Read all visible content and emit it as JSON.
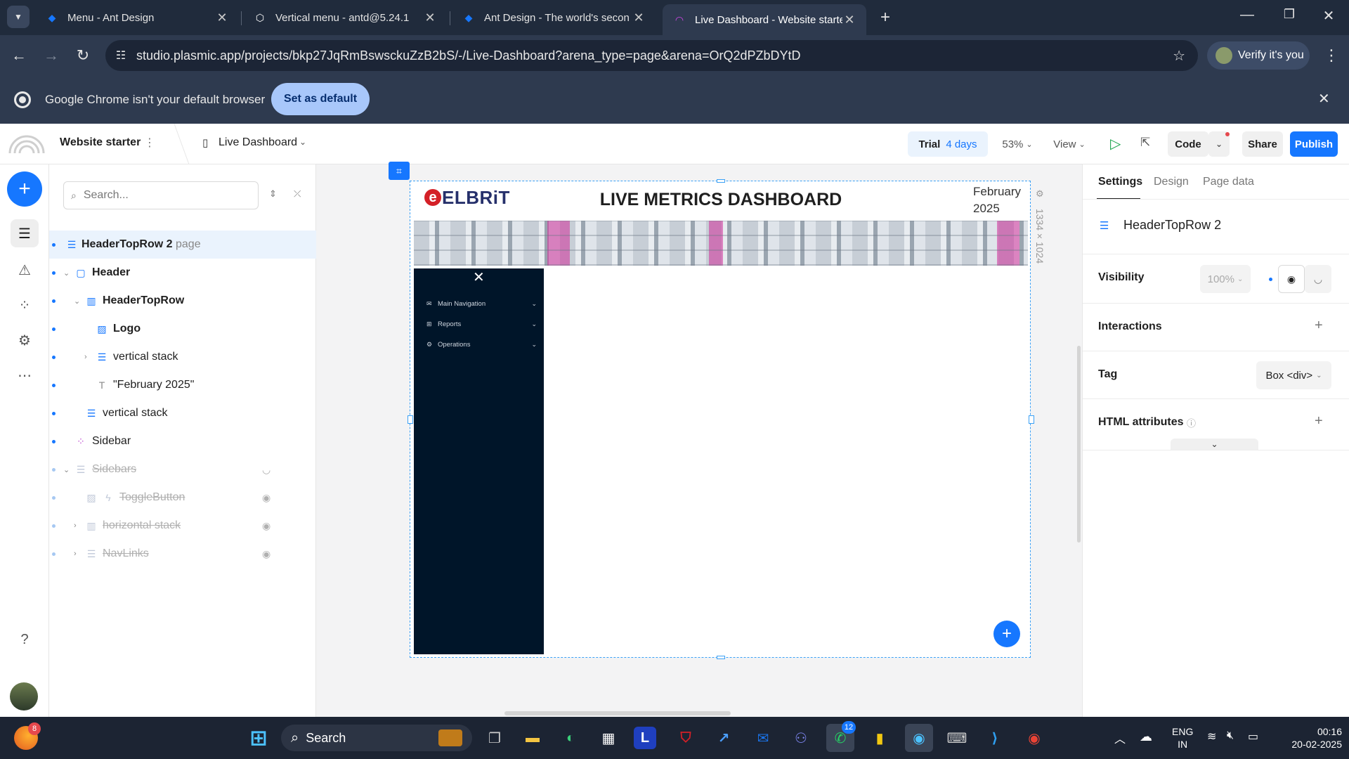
{
  "browser": {
    "tabs": [
      {
        "title": "Menu - Ant Design",
        "icon": "ant-design-icon"
      },
      {
        "title": "Vertical menu - antd@5.24.1",
        "icon": "codesandbox-icon"
      },
      {
        "title": "Ant Design - The world's secon",
        "icon": "ant-design-icon"
      },
      {
        "title": "Live Dashboard - Website starte",
        "icon": "plasmic-icon"
      }
    ],
    "url": "studio.plasmic.app/projects/bkp27JqRmBswsckuZzB2bS/-/Live-Dashboard?arena_type=page&arena=OrQ2dPZbDYtD",
    "verify_label": "Verify it's you",
    "infobar_text": "Google Chrome isn't your default browser",
    "set_default_label": "Set as default"
  },
  "studio": {
    "project_name": "Website starter",
    "page_name": "Live Dashboard",
    "trial_label": "Trial",
    "trial_days": "4 days",
    "zoom": "53%",
    "view_label": "View",
    "code_label": "Code",
    "share_label": "Share",
    "publish_label": "Publish"
  },
  "outline": {
    "search_placeholder": "Search...",
    "items": [
      {
        "label": "HeaderTopRow 2",
        "suffix": "page"
      },
      {
        "label": "Header"
      },
      {
        "label": "HeaderTopRow"
      },
      {
        "label": "Logo"
      },
      {
        "label": "vertical stack"
      },
      {
        "label": "\"February 2025\""
      },
      {
        "label": "vertical stack"
      },
      {
        "label": "Sidebar"
      },
      {
        "label": "Sidebars"
      },
      {
        "label": "ToggleButton"
      },
      {
        "label": "horizontal stack"
      },
      {
        "label": "NavLinks"
      }
    ]
  },
  "canvas": {
    "logo_text": "ELBRiT",
    "dashboard_title": "LIVE METRICS DASHBOARD",
    "date_line1": "February",
    "date_line2": "2025",
    "size_label": "1334 × 1024",
    "sidebar_menu": [
      {
        "label": "Main Navigation",
        "icon": "mail-icon"
      },
      {
        "label": "Reports",
        "icon": "grid-icon"
      },
      {
        "label": "Operations",
        "icon": "gear-icon"
      }
    ]
  },
  "right_panel": {
    "tabs": [
      "Settings",
      "Design",
      "Page data"
    ],
    "component_name": "HeaderTopRow 2",
    "visibility_label": "Visibility",
    "visibility_value": "100%",
    "interactions_label": "Interactions",
    "tag_label": "Tag",
    "tag_value": "Box <div>",
    "html_attributes_label": "HTML attributes"
  },
  "taskbar": {
    "search_label": "Search",
    "language_line1": "ENG",
    "language_line2": "IN",
    "time": "00:16",
    "date": "20-02-2025",
    "whatsapp_badge": "12",
    "firefox_badge": "8"
  },
  "colors": {
    "accent": "#1677ff",
    "sidebar_bg": "#001529",
    "browser_bg": "#202b3c",
    "taskbar_bg": "#1c2433"
  }
}
